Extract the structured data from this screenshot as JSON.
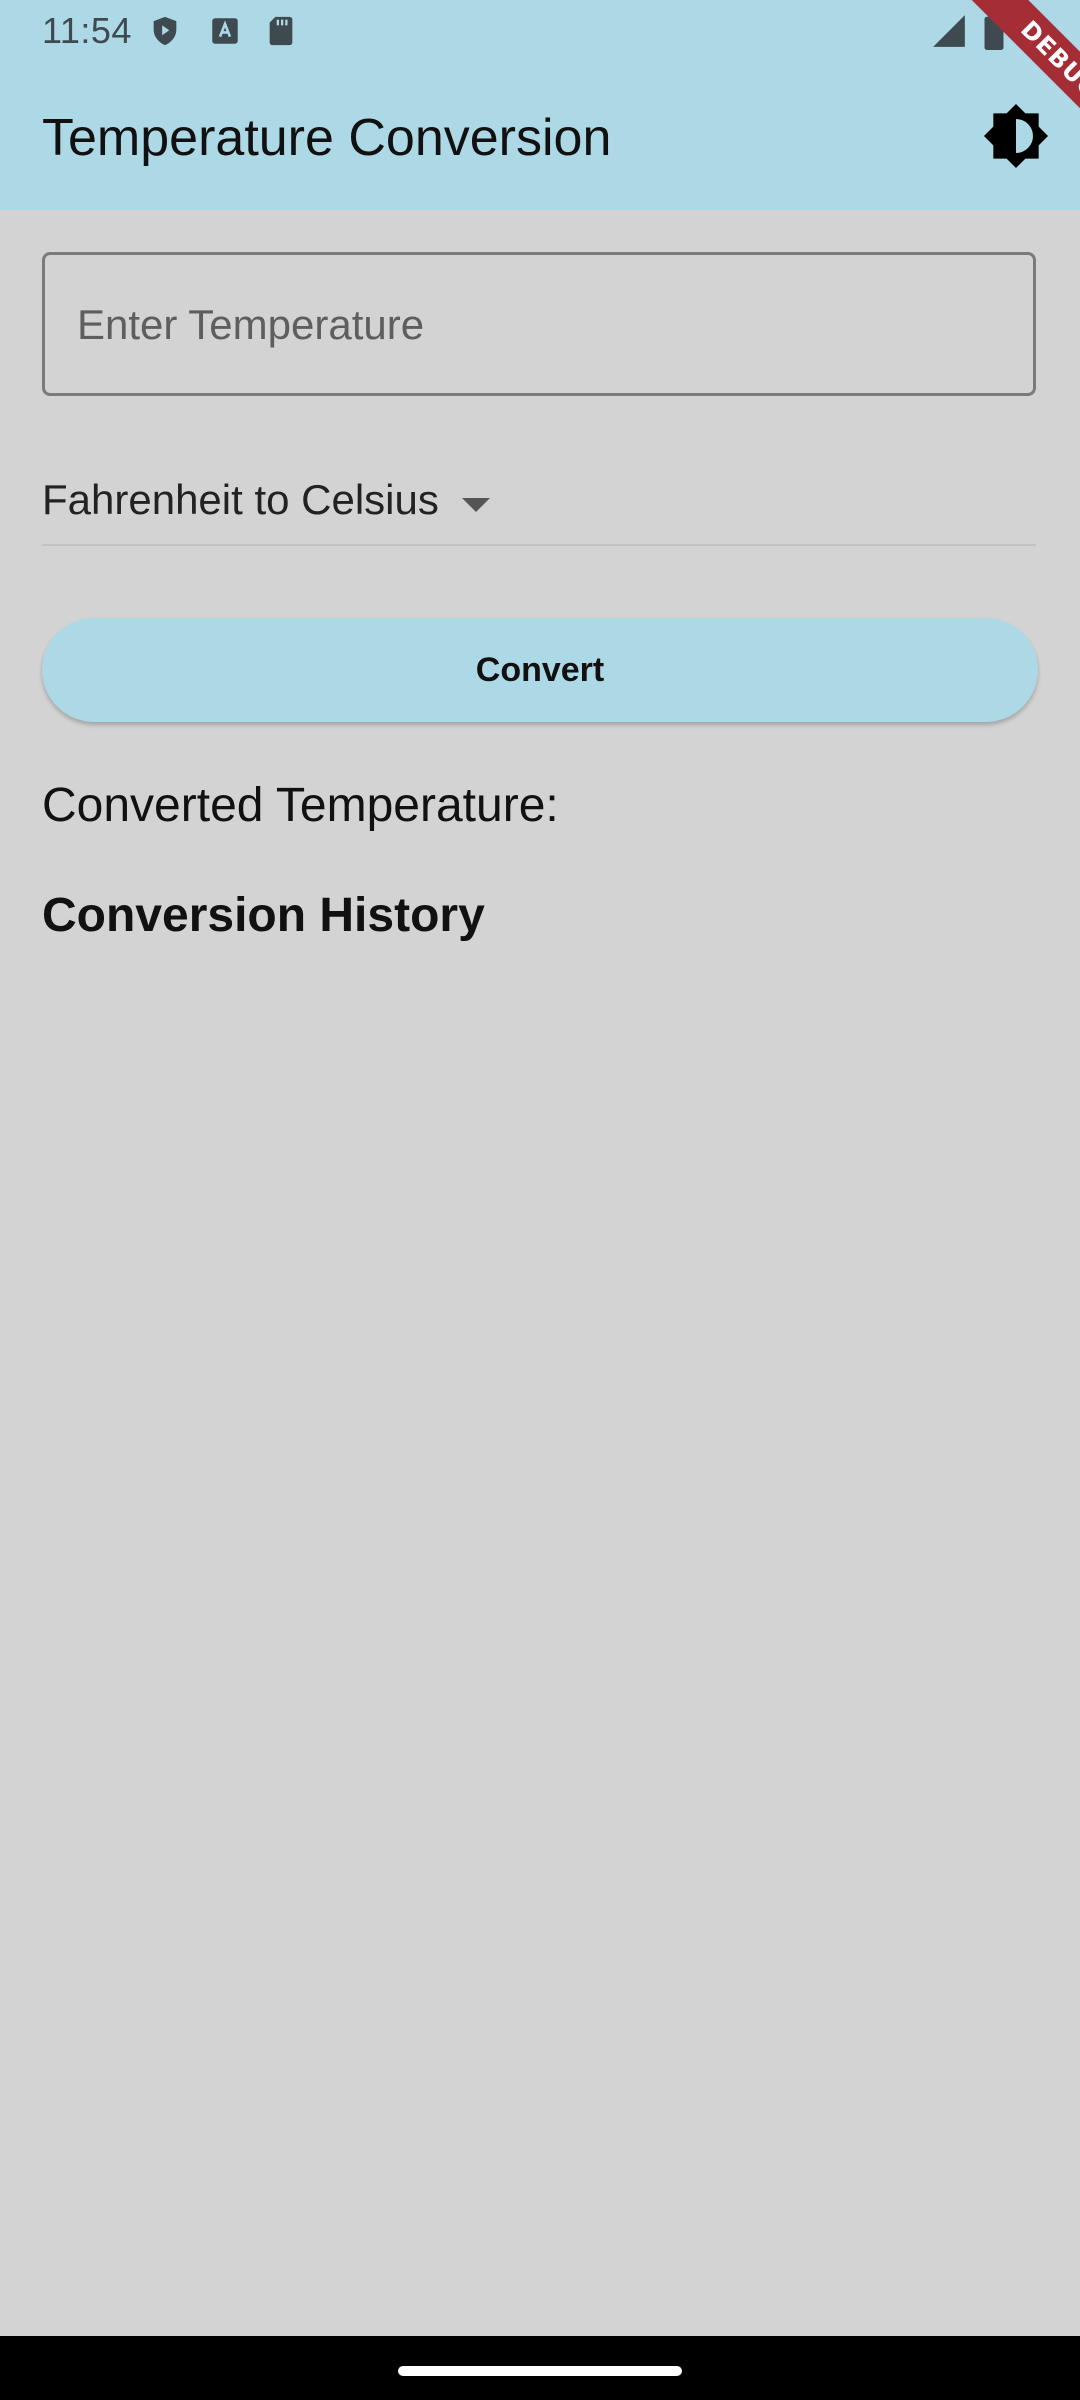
{
  "status_bar": {
    "time": "11:54"
  },
  "app_bar": {
    "title": "Temperature Conversion",
    "theme_toggle_icon": "brightness-icon",
    "background_color": "#add8e6"
  },
  "debug_banner": {
    "label": "DEBUG",
    "color": "#a42d36"
  },
  "form": {
    "temperature_input": {
      "value": "",
      "placeholder": "Enter Temperature"
    },
    "conversion_select": {
      "selected": "Fahrenheit to Celsius"
    },
    "convert_label": "Convert"
  },
  "result": {
    "label": "Converted Temperature:"
  },
  "history": {
    "heading": "Conversion History",
    "items": []
  },
  "colors": {
    "background": "#d3d3d3",
    "accent": "#add8e6"
  }
}
